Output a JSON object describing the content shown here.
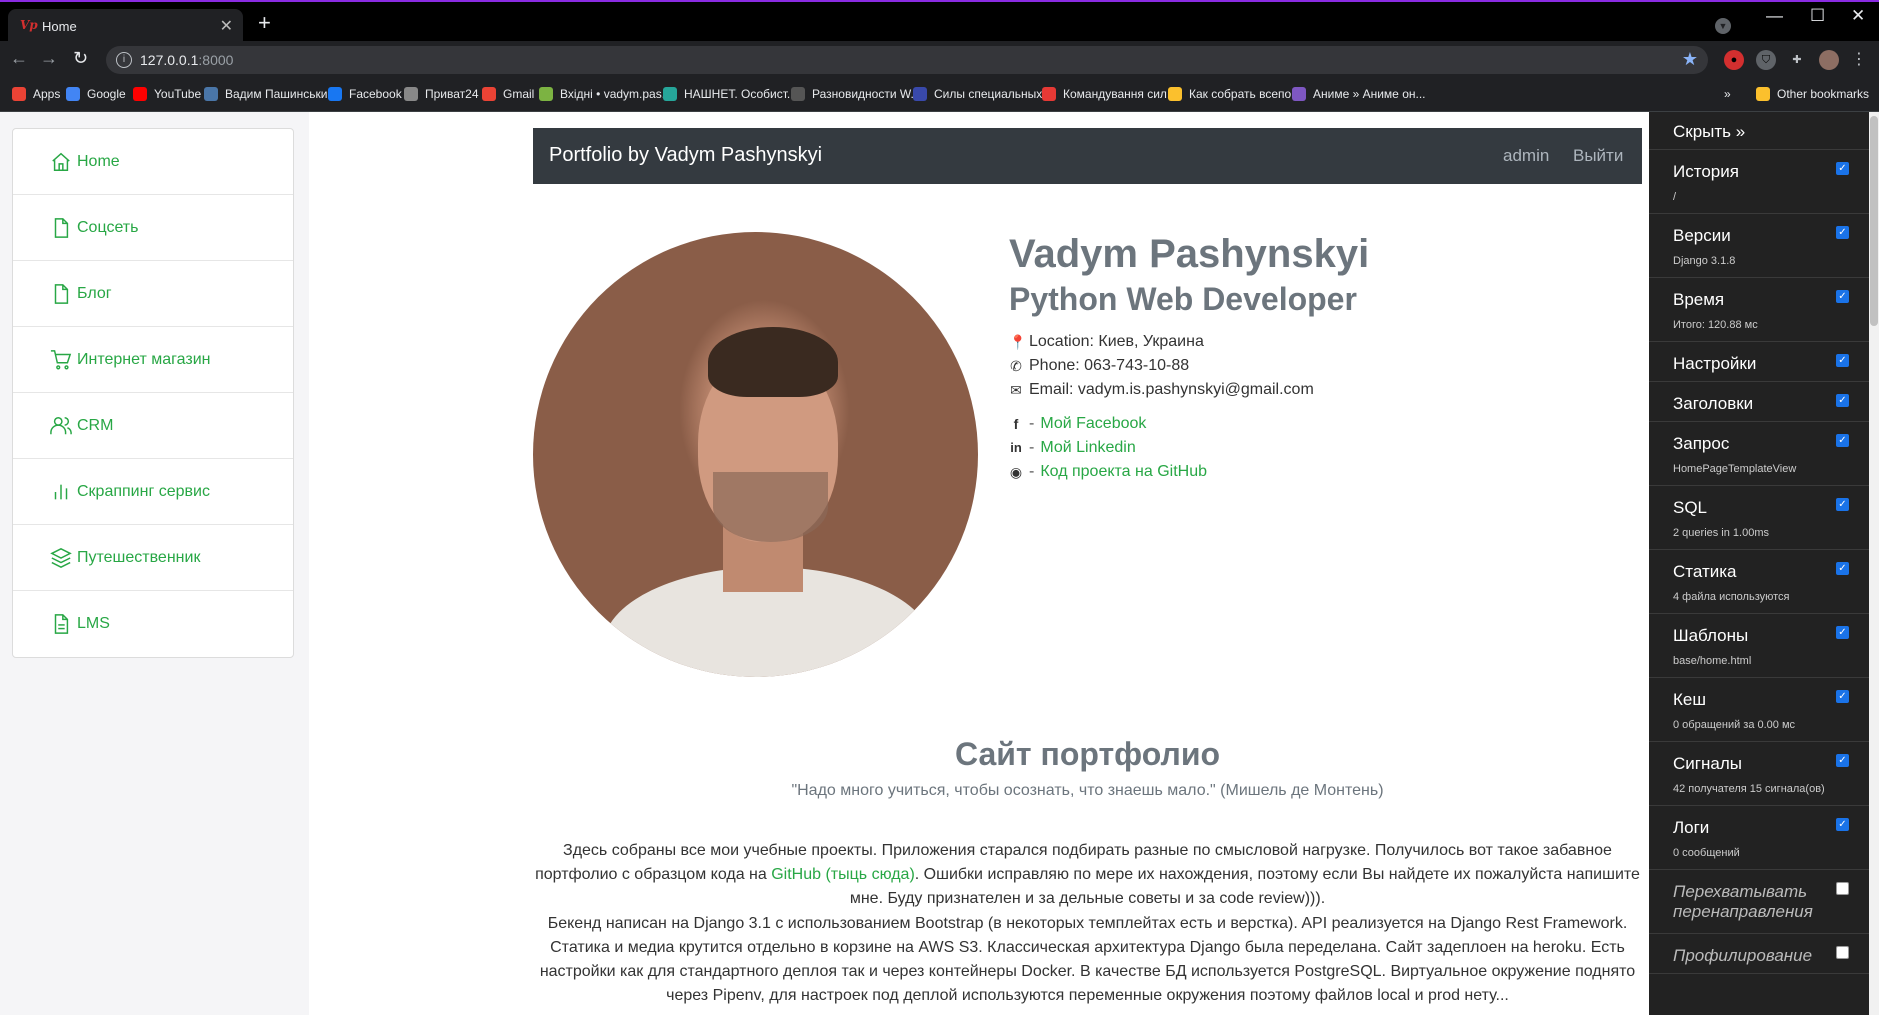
{
  "browser": {
    "tab_title": "Home",
    "tab_favicon": "Vp",
    "url_host": "127.0.0.1",
    "url_port": ":8000",
    "bookmarks": [
      {
        "label": "Apps",
        "icon": "apps-grid-icon",
        "color": "#ea4335"
      },
      {
        "label": "Google",
        "icon": "google-icon",
        "color": "#4285f4"
      },
      {
        "label": "YouTube",
        "icon": "youtube-icon",
        "color": "#ff0000"
      },
      {
        "label": "Вадим Пашинський",
        "icon": "vk-icon",
        "color": "#4a76a8"
      },
      {
        "label": "Facebook",
        "icon": "facebook-icon",
        "color": "#1877f2"
      },
      {
        "label": "Приват24",
        "icon": "privat24-icon",
        "color": "#888888"
      },
      {
        "label": "Gmail",
        "icon": "gmail-icon",
        "color": "#ea4335"
      },
      {
        "label": "Вхідні • vadym.pas...",
        "icon": "inbox-icon",
        "color": "#7cb342"
      },
      {
        "label": "НАШНЕТ. Особист...",
        "icon": "nashnet-icon",
        "color": "#26a69a"
      },
      {
        "label": "Разновидности W...",
        "icon": "generic-icon",
        "color": "#555555"
      },
      {
        "label": "Силы специальных...",
        "icon": "pin-icon",
        "color": "#3949ab"
      },
      {
        "label": "Командування сил...",
        "icon": "emblem-icon",
        "color": "#e53935"
      },
      {
        "label": "Как собрать всепо...",
        "icon": "m-icon",
        "color": "#fbc02d"
      },
      {
        "label": "Аниме » Аниме он...",
        "icon": "anime-icon",
        "color": "#7e57c2"
      }
    ],
    "other_bookmarks": "Other bookmarks"
  },
  "sidebar": {
    "items": [
      {
        "label": "Home",
        "icon": "home-icon"
      },
      {
        "label": "Соцсеть",
        "icon": "file-icon"
      },
      {
        "label": "Блог",
        "icon": "file-icon"
      },
      {
        "label": "Интернет магазин",
        "icon": "cart-icon"
      },
      {
        "label": "CRM",
        "icon": "users-icon"
      },
      {
        "label": "Скраппинг сервис",
        "icon": "bar-chart-icon"
      },
      {
        "label": "Путешественник",
        "icon": "layers-icon"
      },
      {
        "label": "LMS",
        "icon": "file-text-icon"
      }
    ]
  },
  "navbar": {
    "brand": "Portfolio by Vadym Pashynskyi",
    "admin": "admin",
    "logout": "Выйти"
  },
  "profile": {
    "name": "Vadym Pashynskyi",
    "title": "Python Web Developer",
    "location": "Location: Киев, Украина",
    "phone": "Phone: 063-743-10-88",
    "email": "Email: vadym.is.pashynskyi@gmail.com",
    "facebook": "Мой Facebook",
    "linkedin": "Мой Linkedin",
    "github": "Код проекта на GitHub"
  },
  "about": {
    "title": "Сайт портфолио",
    "quote": "\"Надо много учиться, чтобы осознать, что знаешь мало.\" (Мишель де Монтень)",
    "p1_before": "Здесь собраны все мои учебные проекты. Приложения старался подбирать разные по смысловой нагрузке. Получилось вот такое забавное портфолио с образцом кода на ",
    "p1_link": "GitHub (тыць сюда)",
    "p1_after": ". Ошибки исправляю по мере их нахождения, поэтому если Вы найдете их пожалуйста напишите мне. Буду признателен и за дельные советы и за code review))).",
    "p2": "Бекенд написан на Django 3.1 с использованием Bootstrap (в некоторых темплейтах есть и верстка). API реализуется на Django Rest Framework. Статика и медиа крутится отдельно в корзине на AWS S3. Классическая архитектура Django была переделана. Сайт задеплоен на heroku. Есть настройки как для стандартного деплоя так и через контейнеры Docker. В качестве БД используется PostgreSQL. Виртуальное окружение поднято через Pipenv, для настроек под деплой используются переменные окружения поэтому файлов local и prod нету..."
  },
  "debug_toolbar": {
    "hide": "Скрыть »",
    "panels": [
      {
        "title": "История",
        "sub": "/",
        "checked": true
      },
      {
        "title": "Версии",
        "sub": "Django 3.1.8",
        "checked": true
      },
      {
        "title": "Время",
        "sub": "Итого: 120.88 мс",
        "checked": true
      },
      {
        "title": "Настройки",
        "sub": "",
        "checked": true
      },
      {
        "title": "Заголовки",
        "sub": "",
        "checked": true
      },
      {
        "title": "Запрос",
        "sub": "HomePageTemplateView",
        "checked": true
      },
      {
        "title": "SQL",
        "sub": "2 queries in 1.00ms",
        "checked": true
      },
      {
        "title": "Статика",
        "sub": "4 файла используются",
        "checked": true
      },
      {
        "title": "Шаблоны",
        "sub": "base/home.html",
        "checked": true
      },
      {
        "title": "Кеш",
        "sub": "0 обращений за 0.00 мс",
        "checked": true
      },
      {
        "title": "Сигналы",
        "sub": "42 получателя 15 сигнала(ов)",
        "checked": true
      },
      {
        "title": "Логи",
        "sub": "0 сообщений",
        "checked": true
      },
      {
        "title": "Перехватывать перенаправления",
        "sub": "",
        "checked": false,
        "italic": true
      },
      {
        "title": "Профилирование",
        "sub": "",
        "checked": false,
        "italic": true
      }
    ]
  },
  "colors": {
    "accent_green": "#28a745",
    "navbar_bg": "#343a40",
    "toolbar_bg": "#222222"
  }
}
